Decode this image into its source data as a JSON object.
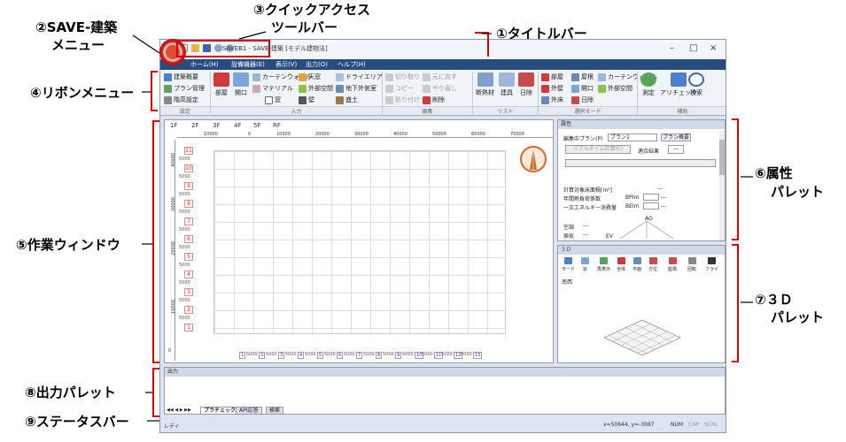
{
  "callouts": {
    "c1": "①タイトルバー",
    "c2a": "②SAVE-建築",
    "c2b": "メニュー",
    "c3a": "③クイックアクセス",
    "c3b": "ツールバー",
    "c4": "④リボンメニュー",
    "c5": "⑤作業ウィンドウ",
    "c6a": "⑥属性",
    "c6b": "パレット",
    "c7a": "⑦３Ｄ",
    "c7b": "パレット",
    "c8": "⑧出力パレット",
    "c9": "⑨ステータスバー"
  },
  "window": {
    "title": "SAVEB1 - SAVE-建築 [モデル建物法]",
    "min": "–",
    "max": "□",
    "close": "×"
  },
  "menu": [
    "ホーム(H)",
    "設備機器(E)",
    "表示(V)",
    "出力(O)",
    "ヘルプ(H)"
  ],
  "ribbon": {
    "b_gaiyo": "建築概要",
    "b_plan": "プラン管理",
    "b_kaidaka": "階高設定",
    "b_heya": "部屋",
    "b_kaiko": "開口",
    "b_curtain": "カーテンウォール",
    "b_material": "マテリアル",
    "b_mado": "窓",
    "b_tenjo": "天窓",
    "b_gaibu": "外部空間",
    "b_kabe": "壁",
    "b_dry": "ドライエリア",
    "b_chika": "地下外気室",
    "b_dodai": "盛土",
    "b_kiritori": "切り取り",
    "b_modosu": "元に戻す",
    "b_copy": "コピー",
    "b_yarinaoshi": "やり直し",
    "b_haritsuke": "貼り付け",
    "b_sakujo": "削除",
    "b_danpou": "断熱材",
    "b_tategu": "建具",
    "b_hiyoke": "日除",
    "s_heya": "部屋",
    "s_okujo": "屋根",
    "s_curtain": "カーテンウォール",
    "s_gaiheki": "外壁",
    "s_kaiko": "開口",
    "s_gaibu": "外部空間",
    "s_gaiyuka": "外床",
    "s_hiyoke": "日除",
    "b_sokutei": "測定",
    "b_check": "アリチェック",
    "b_kensaku": "検索",
    "g_settei": "設定",
    "g_nyuryoku": "入力",
    "g_henshu": "編集",
    "g_list": "リスト",
    "g_sentaku": "選択モード",
    "g_hojo": "補助"
  },
  "work": {
    "floors": [
      "1F",
      "2F",
      "3F",
      "4F",
      "5F",
      "RF"
    ],
    "h_ruler": [
      "10000",
      "0",
      "10000",
      "20000",
      "30000",
      "40000",
      "50000",
      "60000",
      "70000"
    ],
    "v_ruler": [
      "40000",
      "30000",
      "20000",
      "10000",
      "0"
    ],
    "row_nums": [
      "11",
      "10",
      "9",
      "8",
      "7",
      "6",
      "5",
      "4",
      "3",
      "2",
      "1"
    ],
    "row_lab": "5000",
    "col_nums": [
      "1",
      "2",
      "3",
      "4",
      "5",
      "6",
      "7",
      "8",
      "9",
      "10",
      "11",
      "12",
      "13"
    ],
    "col_lab": "5000"
  },
  "attr": {
    "title": "属性",
    "plan_label": "編集中プラン(P)",
    "plan_value": "プラン1",
    "plan_btn": "プラン概要",
    "calc_btn": "リアルタイム計算(C)",
    "result_label": "適合結果",
    "result_val": "---",
    "area_label": "計算対象床面積[m²]",
    "area_val": "---",
    "pal_label": "年間熱負荷係数",
    "bpi": "BPIm",
    "pal_val": "---",
    "energy_label": "一次エネルギー消費量",
    "bei": "BEIm",
    "energy_val": "---",
    "kucho": "空調",
    "kucho_val": "---",
    "kanki": "換気",
    "kanki_val": "---",
    "ao": "AO",
    "ev": "EV"
  },
  "p3d": {
    "title": "３Ｄ",
    "tools": [
      "モード",
      "窓",
      "再表示",
      "全体",
      "平面",
      "方位",
      "座標",
      "回転",
      "フライ"
    ],
    "view_label": "南西"
  },
  "output": {
    "title": "出力",
    "nav": "◀◀ ◀ ▶ ▶▶",
    "tabs": [
      "プラチェック",
      "API応答",
      "検索"
    ]
  },
  "status": {
    "left": "レディ",
    "coords": "x=50644, y=-3087",
    "num": "NUM",
    "cap": "CAP",
    "scrl": "SCRL"
  },
  "colors": {
    "callout_red": "#dd0000",
    "menubar": "#274c80"
  }
}
